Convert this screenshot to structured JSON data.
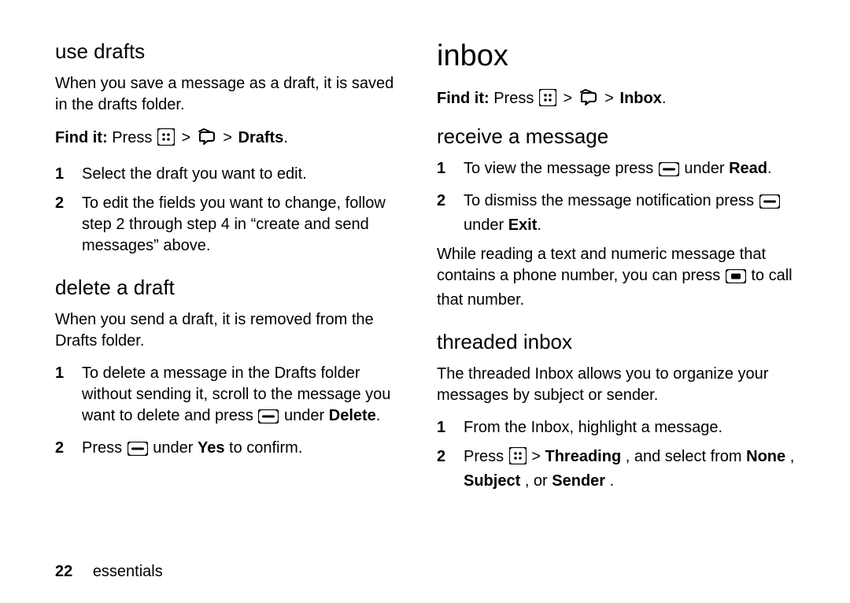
{
  "left": {
    "h_use_drafts": "use drafts",
    "p_use_drafts": "When you save a message as a draft, it is saved in the drafts folder.",
    "findit_lbl": "Find it:",
    "findit_press": "Press",
    "findit_drafts": "Drafts",
    "step_use_1": "Select the draft you want to edit.",
    "step_use_2": "To edit the fields you want to change, follow step 2 through step 4 in “create and send messages” above.",
    "h_delete": "delete a draft",
    "p_delete": "When you send a draft, it is removed from the Drafts folder.",
    "step_del_1_a": "To delete a message in the Drafts folder without sending it, scroll to the message you want to delete and press ",
    "step_del_1_b": " under ",
    "step_del_1_c": "Delete",
    "step_del_2_a": "Press ",
    "step_del_2_b": " under ",
    "step_del_2_yes": "Yes",
    "step_del_2_c": " to confirm."
  },
  "right": {
    "h_inbox": "inbox",
    "findit_lbl": "Find it:",
    "findit_press": "Press",
    "findit_inbox": "Inbox",
    "h_receive": "receive a message",
    "step_rx_1_a": "To view the message press ",
    "step_rx_1_b": " under ",
    "step_rx_1_read": "Read",
    "step_rx_2_a": "To dismiss the message notification press ",
    "step_rx_2_b": " under ",
    "step_rx_2_exit": "Exit",
    "p_while_a": "While reading a text and numeric message that contains a phone number, you can press ",
    "p_while_b": " to call that number.",
    "h_threaded": "threaded inbox",
    "p_threaded": "The threaded Inbox allows you to organize your messages by subject or sender.",
    "step_th_1": "From the Inbox, highlight a message.",
    "step_th_2_a": "Press ",
    "step_th_2_b": " > ",
    "step_th_2_thread": "Threading",
    "step_th_2_c": ", and select from ",
    "step_th_2_none": "None",
    "step_th_2_d": ", ",
    "step_th_2_subject": "Subject",
    "step_th_2_e": ", or ",
    "step_th_2_sender": "Sender",
    "step_th_2_f": "."
  },
  "footer": {
    "page": "22",
    "section": "essentials"
  },
  "glyphs": {
    "gt": ">"
  }
}
